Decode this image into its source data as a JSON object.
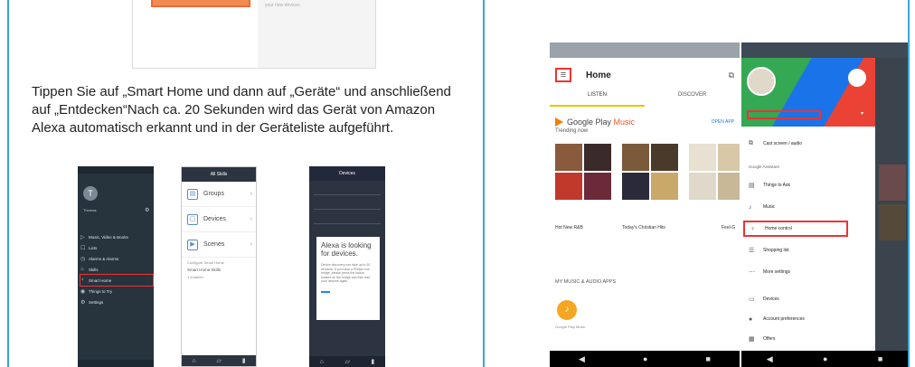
{
  "description": "Tippen Sie auf „Smart Home und dann auf „Geräte“ und anschließend auf „Entdecken“Nach ca. 20 Sekunden wird das Gerät von Amazon Alexa automatisch erkannt und in der Geräteliste aufgeführt.",
  "top_image": {
    "caption": "your new devices."
  },
  "alexa_menu": {
    "avatar": "T",
    "user_name": "Thomas",
    "items": [
      {
        "icon": "▷",
        "label": "Music, Video & Books"
      },
      {
        "icon": "☐",
        "label": "Lists"
      },
      {
        "icon": "◷",
        "label": "Alarms & Alarms"
      },
      {
        "icon": "⌂",
        "label": "Skills"
      },
      {
        "icon": "♀",
        "label": "Smart Home"
      },
      {
        "icon": "◉",
        "label": "Things to Try"
      },
      {
        "icon": "⚙",
        "label": "Settings"
      }
    ]
  },
  "alexa_smarthome": {
    "header": "All Skills",
    "items": [
      {
        "icon": "▤",
        "label": "Groups"
      },
      {
        "icon": "▢",
        "label": "Devices"
      },
      {
        "icon": "▶",
        "label": "Scenes"
      }
    ],
    "configure": "Configure Smart Home",
    "skills_title": "Smart Home Skills",
    "skills_sub": "1 enabled"
  },
  "alexa_discover": {
    "header": "Devices",
    "dialog_title": "Alexa is looking for devices.",
    "dialog_text": "Device discovery can take up to 20 seconds. If you have a Philips Hue bridge, please press the button located on the bridge and then add your devices again."
  },
  "google_home": {
    "title": "Home",
    "tabs": [
      "LISTEN",
      "DISCOVER"
    ],
    "gpm_name": "Google Play ",
    "gpm_music": "Music",
    "open_app": "OPEN APP",
    "trending": "Trending now",
    "playlists": [
      "Hot New R&B",
      "Today's Christian Hits",
      "Feel-G"
    ],
    "my_music": "MY MUSIC & AUDIO APPS",
    "gp_label": "Google Play Music",
    "nav": [
      "◀",
      "●",
      "■"
    ]
  },
  "drawer": {
    "cast": "Cast screen / audio",
    "section": "Google Assistant",
    "items": [
      {
        "icon": "▤",
        "label": "Things to Ask"
      },
      {
        "icon": "♪",
        "label": "Music"
      },
      {
        "icon": "♀",
        "label": "Home control"
      },
      {
        "icon": "☰",
        "label": "Shopping list"
      },
      {
        "icon": "⋯",
        "label": "More settings"
      },
      {
        "icon": "▭",
        "label": "Devices"
      },
      {
        "icon": "●",
        "label": "Account preferences"
      },
      {
        "icon": "▦",
        "label": "Offers"
      }
    ]
  }
}
